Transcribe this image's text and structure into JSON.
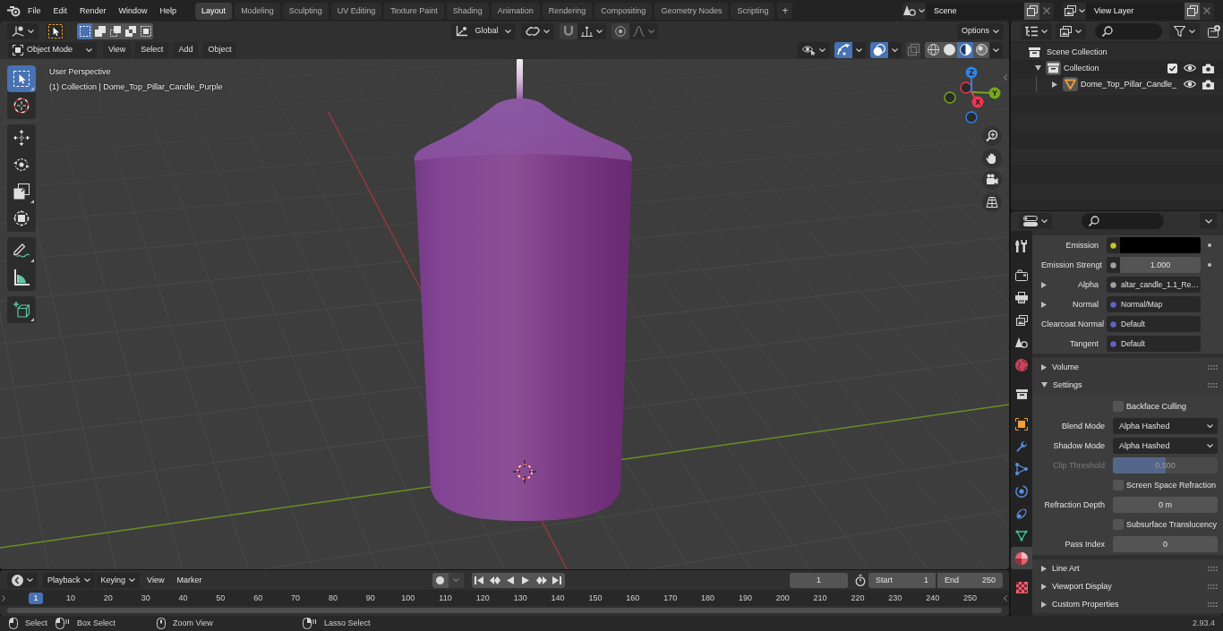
{
  "top_bar": {
    "menus": [
      "File",
      "Edit",
      "Render",
      "Window",
      "Help"
    ],
    "workspaces": [
      {
        "label": "Layout",
        "selected": true
      },
      {
        "label": "Modeling",
        "selected": false
      },
      {
        "label": "Sculpting",
        "selected": false
      },
      {
        "label": "UV Editing",
        "selected": false
      },
      {
        "label": "Texture Paint",
        "selected": false
      },
      {
        "label": "Shading",
        "selected": false
      },
      {
        "label": "Animation",
        "selected": false
      },
      {
        "label": "Rendering",
        "selected": false
      },
      {
        "label": "Compositing",
        "selected": false
      },
      {
        "label": "Geometry Nodes",
        "selected": false
      },
      {
        "label": "Scripting",
        "selected": false
      }
    ],
    "add_workspace": "+",
    "scene": "Scene",
    "view_layer": "View Layer"
  },
  "viewport": {
    "header": {
      "select_modes": [
        {
          "kind": "set",
          "selected": true
        },
        {
          "kind": "extend",
          "selected": false
        },
        {
          "kind": "subtract",
          "selected": false
        },
        {
          "kind": "difference",
          "selected": false
        },
        {
          "kind": "intersect",
          "selected": false
        }
      ],
      "orientation": "Global",
      "snap_on": false,
      "proportional_on": false,
      "options": "Options",
      "mode": "Object Mode",
      "menus": [
        "View",
        "Select",
        "Add",
        "Object"
      ],
      "gizmos_on": true,
      "overlays_on": true,
      "xray_on": false,
      "shading": [
        {
          "kind": "wireframe",
          "selected": false
        },
        {
          "kind": "solid",
          "selected": false
        },
        {
          "kind": "material",
          "selected": true
        },
        {
          "kind": "rendered",
          "selected": false
        }
      ]
    },
    "tool_groups": [
      {
        "tools": [
          {
            "kind": "select_box",
            "selected": true
          },
          {
            "kind": "cursor",
            "selected": false
          }
        ]
      },
      {
        "tools": [
          {
            "kind": "move",
            "selected": false
          },
          {
            "kind": "rotate",
            "selected": false
          },
          {
            "kind": "scale",
            "selected": false
          },
          {
            "kind": "transform",
            "selected": false
          }
        ]
      },
      {
        "tools": [
          {
            "kind": "annotate",
            "selected": false
          },
          {
            "kind": "measure",
            "selected": false
          }
        ]
      },
      {
        "tools": [
          {
            "kind": "add_cube",
            "selected": false
          }
        ]
      }
    ],
    "info": {
      "view": "User Perspective",
      "object": "(1) Collection | Dome_Top_Pillar_Candle_Purple"
    },
    "gizmo_axes": [
      {
        "kind": "z",
        "label": "Z",
        "color": "#2f83e8"
      },
      {
        "kind": "y",
        "label": "Y",
        "color": "#76a81f"
      },
      {
        "kind": "x",
        "label": "X",
        "color": "#f0364f"
      }
    ]
  },
  "outliner": {
    "items": [
      {
        "kind": "collection",
        "label": "Scene Collection",
        "active": false,
        "children": [
          {
            "kind": "collection",
            "label": "Collection",
            "expanded": true,
            "active": true,
            "checked": true,
            "visible": true,
            "renderable": true,
            "children": [
              {
                "kind": "mesh",
                "label": "Dome_Top_Pillar_Candle_",
                "expanded": false,
                "active": true,
                "visible": true,
                "renderable": true
              }
            ]
          }
        ]
      }
    ]
  },
  "properties": {
    "tab_groups": [
      {
        "tabs": [
          {
            "kind": "tool",
            "selected": false
          }
        ]
      },
      {
        "tabs": [
          {
            "kind": "render",
            "selected": false
          },
          {
            "kind": "output",
            "selected": false
          },
          {
            "kind": "view_layer",
            "selected": false
          },
          {
            "kind": "scene",
            "selected": false
          },
          {
            "kind": "world",
            "selected": false
          }
        ]
      },
      {
        "tabs": [
          {
            "kind": "collection",
            "selected": false
          }
        ]
      },
      {
        "tabs": [
          {
            "kind": "object",
            "selected": false
          },
          {
            "kind": "modifiers",
            "selected": false
          },
          {
            "kind": "particles",
            "selected": false
          },
          {
            "kind": "physics",
            "selected": false
          },
          {
            "kind": "constraints",
            "selected": false
          },
          {
            "kind": "data",
            "selected": false
          },
          {
            "kind": "material",
            "selected": true
          }
        ]
      },
      {
        "tabs": [
          {
            "kind": "texture",
            "selected": false
          }
        ]
      }
    ],
    "inputs": [
      {
        "kind": "color",
        "label": "Emission",
        "socket": {
          "color": "#c7c729"
        },
        "swatch": {
          "color": "#000000"
        },
        "animatable": true
      },
      {
        "kind": "number",
        "label": "Emission Strengt",
        "socket": {
          "color": "#a1a1a1"
        },
        "value": "1.000",
        "animatable": true
      },
      {
        "kind": "link",
        "label": "Alpha",
        "expanded": false,
        "socket": {
          "color": "#a1a1a1"
        },
        "value": "altar_candle_1.1_Re…",
        "animatable": false
      },
      {
        "kind": "link",
        "label": "Normal",
        "expanded": false,
        "socket": {
          "color": "#6363c7"
        },
        "value": "Normal/Map",
        "animatable": false
      },
      {
        "kind": "link",
        "label": "Clearcoat Normal",
        "socket": {
          "color": "#6363c7"
        },
        "value": "Default",
        "animatable": false
      },
      {
        "kind": "link",
        "label": "Tangent",
        "socket": {
          "color": "#6363c7"
        },
        "value": "Default",
        "animatable": false
      }
    ],
    "sections": [
      {
        "label": "Volume",
        "expanded": false
      },
      {
        "label": "Settings",
        "expanded": true,
        "rows": [
          {
            "kind": "checkbox",
            "label": "Backface Culling",
            "checked": false,
            "disabled": false
          },
          {
            "kind": "dropdown",
            "label": "Blend Mode",
            "value": "Alpha Hashed",
            "disabled": false
          },
          {
            "kind": "dropdown",
            "label": "Shadow Mode",
            "value": "Alpha Hashed",
            "disabled": false
          },
          {
            "kind": "slider",
            "label": "Clip Threshold",
            "value": "0.500",
            "level": 0.5,
            "disabled": true
          },
          {
            "kind": "checkbox",
            "label": "Screen Space Refraction",
            "checked": false,
            "disabled": false
          },
          {
            "kind": "number",
            "label": "Refraction Depth",
            "value": "0 m",
            "disabled": false
          },
          {
            "kind": "checkbox",
            "label": "Subsurface Translucency",
            "checked": false,
            "disabled": false
          },
          {
            "kind": "number",
            "label": "Pass Index",
            "value": "0",
            "disabled": false
          }
        ]
      },
      {
        "label": "Line Art",
        "expanded": false
      },
      {
        "label": "Viewport Display",
        "expanded": false
      },
      {
        "label": "Custom Properties",
        "expanded": false
      }
    ]
  },
  "timeline": {
    "menus": [
      {
        "kind": "dropdown",
        "label": "Playback"
      },
      {
        "kind": "dropdown",
        "label": "Keying"
      },
      {
        "kind": "menu",
        "label": "View"
      },
      {
        "kind": "menu",
        "label": "Marker"
      }
    ],
    "auto_keying": false,
    "current_frame": "1",
    "start_label": "Start",
    "start": "1",
    "end_label": "End",
    "end": "250",
    "frames": [
      {
        "label": "1",
        "selected": true
      },
      {
        "label": "10",
        "selected": false
      },
      {
        "label": "20",
        "selected": false
      },
      {
        "label": "30",
        "selected": false
      },
      {
        "label": "40",
        "selected": false
      },
      {
        "label": "50",
        "selected": false
      },
      {
        "label": "60",
        "selected": false
      },
      {
        "label": "70",
        "selected": false
      },
      {
        "label": "80",
        "selected": false
      },
      {
        "label": "90",
        "selected": false
      },
      {
        "label": "100",
        "selected": false
      },
      {
        "label": "110",
        "selected": false
      },
      {
        "label": "120",
        "selected": false
      },
      {
        "label": "130",
        "selected": false
      },
      {
        "label": "140",
        "selected": false
      },
      {
        "label": "150",
        "selected": false
      },
      {
        "label": "160",
        "selected": false
      },
      {
        "label": "170",
        "selected": false
      },
      {
        "label": "180",
        "selected": false
      },
      {
        "label": "190",
        "selected": false
      },
      {
        "label": "200",
        "selected": false
      },
      {
        "label": "210",
        "selected": false
      },
      {
        "label": "220",
        "selected": false
      },
      {
        "label": "230",
        "selected": false
      },
      {
        "label": "240",
        "selected": false
      },
      {
        "label": "250",
        "selected": false
      }
    ]
  },
  "status_bar": {
    "hints": [
      {
        "kind": "left",
        "label": "Select"
      },
      {
        "kind": "left_drag",
        "label": "Box Select"
      },
      {
        "kind": "middle",
        "label": "Zoom View"
      },
      {
        "kind": "right_drag",
        "label": "Lasso Select"
      }
    ],
    "version": "2.93.4"
  }
}
